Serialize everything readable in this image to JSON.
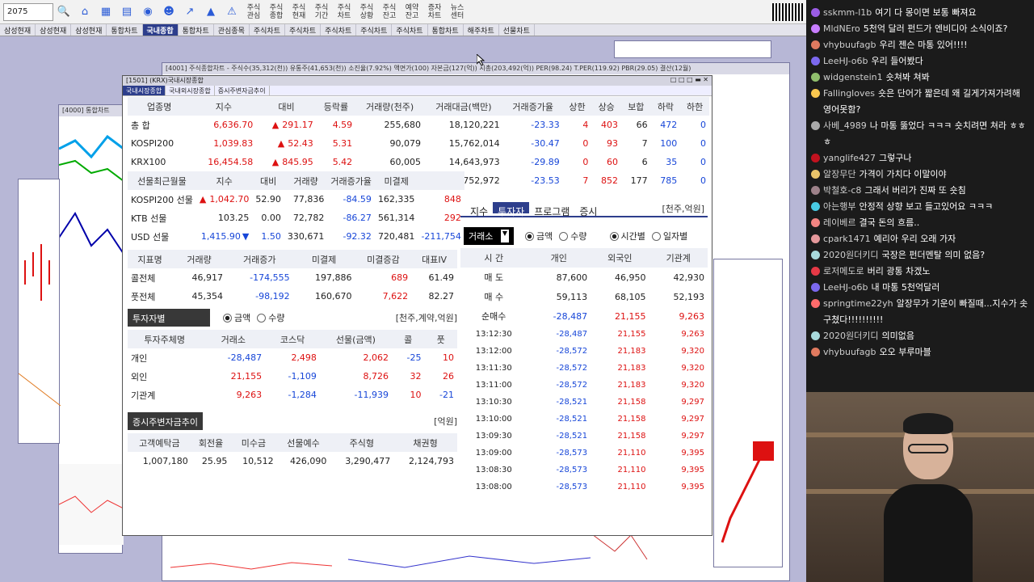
{
  "toolbar": {
    "code": "2075",
    "buttons": [
      "주식\n관심",
      "주식\n종합",
      "주식\n현재",
      "주식\n기간",
      "주식\n차트",
      "주식\n상황",
      "주식\n잔고",
      "예약\n잔고",
      "증자\n차트",
      "뉴스\n센터"
    ]
  },
  "tabs": [
    "삼성현재",
    "삼성현재",
    "삼성현재",
    "통합차트",
    "국내종합",
    "통합차트",
    "관심종목",
    "주식차트",
    "주식차트",
    "주식차트",
    "주식차트",
    "주식차트",
    "통합차트",
    "해주차트",
    "선물차트"
  ],
  "active_tab": 4,
  "main_window": {
    "title": "[1501] (KRX)국내시장종합",
    "subtabs": [
      "국내시장종합",
      "국내외시장종합",
      "증시주변자금추이"
    ],
    "index_headers": [
      "업종명",
      "지수",
      "대비",
      "등락률",
      "거래량(천주)",
      "거래대금(백만)",
      "거래증가율",
      "상한",
      "상승",
      "보합",
      "하락",
      "하한"
    ],
    "index_rows": [
      [
        "총 합",
        "6,636.70",
        "291.17",
        "4.59",
        "255,680",
        "18,120,221",
        "-23.33",
        "4",
        "403",
        "66",
        "472",
        "0"
      ],
      [
        "KOSPI200",
        "1,039.83",
        "52.43",
        "5.31",
        "90,079",
        "15,762,014",
        "-30.47",
        "0",
        "93",
        "7",
        "100",
        "0"
      ],
      [
        "KRX100",
        "16,454.58",
        "845.95",
        "5.42",
        "60,005",
        "14,643,973",
        "-29.89",
        "0",
        "60",
        "6",
        "35",
        "0"
      ],
      [
        "코스닥 종합",
        "859.10",
        "1.26",
        "0.15",
        "407,694",
        "4,752,972",
        "-23.53",
        "7",
        "852",
        "177",
        "785",
        "0"
      ]
    ],
    "futures_headers": [
      "선물최근월물",
      "지수",
      "대비",
      "거래량",
      "거래증가율",
      "미결제",
      ""
    ],
    "futures_rows": [
      [
        "KOSPI200 선물",
        "1,042.70",
        "52.90",
        "77,836",
        "-84.59",
        "162,335",
        "848"
      ],
      [
        "KTB 선물",
        "103.25",
        "0.00",
        "72,782",
        "-86.27",
        "561,314",
        "292"
      ],
      [
        "USD 선물",
        "1,415.90",
        "1.50",
        "330,671",
        "-92.32",
        "720,481",
        "-211,754"
      ]
    ],
    "indicator_headers": [
      "지표명",
      "거래량",
      "거래증가",
      "미결제",
      "미결증감",
      "대표IV"
    ],
    "indicator_rows": [
      [
        "콜전체",
        "46,917",
        "-174,555",
        "197,886",
        "689",
        "61.49"
      ],
      [
        "풋전체",
        "45,354",
        "-98,192",
        "160,670",
        "7,622",
        "82.27"
      ]
    ],
    "investor": {
      "title": "투자자별",
      "radios": [
        "금액",
        "수량"
      ],
      "unit": "[천주,계약,억원]",
      "headers": [
        "투자주체명",
        "거래소",
        "코스닥",
        "선물(금액)",
        "콜",
        "풋"
      ],
      "rows": [
        [
          "개인",
          "-28,487",
          "2,498",
          "2,062",
          "-25",
          "10"
        ],
        [
          "외인",
          "21,155",
          "-1,109",
          "8,726",
          "32",
          "26"
        ],
        [
          "기관계",
          "9,263",
          "-1,284",
          "-11,939",
          "10",
          "-21"
        ]
      ]
    },
    "fund": {
      "title": "증시주변자금추이",
      "unit": "[억원]",
      "headers": [
        "고객예탁금",
        "회전율",
        "미수금",
        "선물예수",
        "주식형",
        "채권형"
      ],
      "row": [
        "1,007,180",
        "25.95",
        "10,512",
        "426,090",
        "3,290,477",
        "2,124,793"
      ]
    },
    "right_panel": {
      "tabs": [
        "지수",
        "투자자",
        "프로그램",
        "증시"
      ],
      "active": 1,
      "unit": "[천주,억원]",
      "market": "거래소",
      "radios1": [
        "금액",
        "수량"
      ],
      "radios2": [
        "시간별",
        "일자별"
      ],
      "headers": [
        "시 간",
        "개인",
        "외국인",
        "기관계"
      ],
      "summary": [
        [
          "매 도",
          "87,600",
          "46,950",
          "42,930"
        ],
        [
          "매 수",
          "59,113",
          "68,105",
          "52,193"
        ],
        [
          "순매수",
          "-28,487",
          "21,155",
          "9,263"
        ]
      ],
      "rows": [
        [
          "13:12:30",
          "-28,487",
          "21,155",
          "9,263"
        ],
        [
          "13:12:00",
          "-28,572",
          "21,183",
          "9,320"
        ],
        [
          "13:11:30",
          "-28,572",
          "21,183",
          "9,320"
        ],
        [
          "13:11:00",
          "-28,572",
          "21,183",
          "9,320"
        ],
        [
          "13:10:30",
          "-28,521",
          "21,158",
          "9,297"
        ],
        [
          "13:10:00",
          "-28,521",
          "21,158",
          "9,297"
        ],
        [
          "13:09:30",
          "-28,521",
          "21,158",
          "9,297"
        ],
        [
          "13:09:00",
          "-28,573",
          "21,110",
          "9,395"
        ],
        [
          "13:08:30",
          "-28,573",
          "21,110",
          "9,395"
        ],
        [
          "13:08:00",
          "-28,573",
          "21,110",
          "9,395"
        ]
      ]
    }
  },
  "chat": [
    {
      "user": "sskmm-l1b",
      "msg": "여기 다 몽이면 보통 빠져요",
      "color": "#9b5de5"
    },
    {
      "user": "MldNEro",
      "msg": "5천억 달러 펀드가 엔비디아 소식이죠?",
      "color": "#c77dff"
    },
    {
      "user": "vhybuufagb",
      "msg": "우리 젠슨 마통 있어!!!!",
      "color": "#e07a5f"
    },
    {
      "user": "LeeHJ-o6b",
      "msg": "우리 들어봤다",
      "color": "#7b68ee"
    },
    {
      "user": "widgenstein1",
      "msg": "숏쳐봐 쳐봐",
      "color": "#90be6d"
    },
    {
      "user": "Fallingloves",
      "msg": "숏은 단어가 짧은데 왜 길게가져가려해 영어못함?",
      "color": "#f9c74f"
    },
    {
      "user": "사베_4989",
      "msg": "나 마통 뚫었다 ㅋㅋㅋ 숏치려면 쳐라 ㅎㅎㅎ",
      "color": "#aaaaaa"
    },
    {
      "user": "yanglife427",
      "msg": "그렇구나",
      "color": "#c1121f"
    },
    {
      "user": "알장무단",
      "msg": "가격이 가치다 이말이야",
      "color": "#e9c46a"
    },
    {
      "user": "박철호-c8",
      "msg": "그래서 버리가 진짜 또 숏침",
      "color": "#9d8189"
    },
    {
      "user": "아는행부",
      "msg": "안정적 상향 보고 들고있어요 ㅋㅋㅋ",
      "color": "#48cae4"
    },
    {
      "user": "레이베르",
      "msg": "결국 돈의 흐름..",
      "color": "#f28482"
    },
    {
      "user": "cpark1471",
      "msg": "예리아 우리 오래 가자",
      "color": "#e5989b"
    },
    {
      "user": "2020원더키디",
      "msg": "국장은 펀더멘탈 의미 없음?",
      "color": "#a8dadc"
    },
    {
      "user": "로저메도로",
      "msg": "버리 광통 차겠노",
      "color": "#e63946"
    },
    {
      "user": "LeeHJ-o6b",
      "msg": "내 마통 5천억달러",
      "color": "#7b68ee"
    },
    {
      "user": "springtime22yh",
      "msg": "알장무가 기운이 빠질때...지수가 솟구쳤다!!!!!!!!!!",
      "color": "#ff6b6b"
    },
    {
      "user": "2020원더키디",
      "msg": "의미없음",
      "color": "#a8dadc"
    },
    {
      "user": "vhybuufagb",
      "msg": "오오 부루마블",
      "color": "#e07a5f"
    }
  ],
  "window_titles": {
    "stock_chart": "[4001] 주식종합차트 - 주식수(35,312(천)) 유통주(41,653(천)) 소진율(7.92%) 액면가(100) 자본금(127(억)) 시총(203,492(억)) PER(98.24) T.PER(119.92) PBR(29.05) 결산(12월)",
    "integrated": "[4000] 통합차트"
  }
}
